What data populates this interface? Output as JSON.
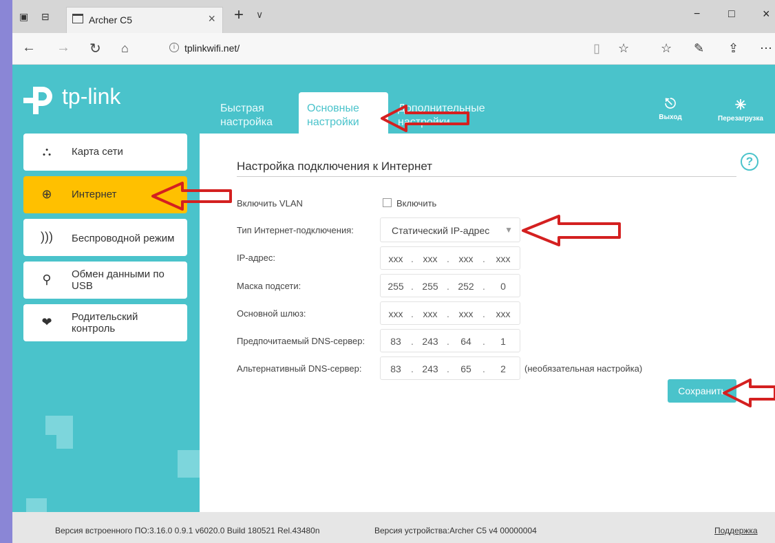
{
  "browser": {
    "tab_title": "Archer C5",
    "tab_close": "×",
    "new_tab": "+",
    "tab_menu": "∨",
    "url": "tplinkwifi.net/",
    "window": {
      "minimize": "−",
      "maximize": "□",
      "close": "×"
    }
  },
  "header": {
    "brand": "tp-link",
    "tabs": [
      {
        "label": "Быстрая настройка"
      },
      {
        "label": "Основные настройки"
      },
      {
        "label": "Дополнительные настройки"
      }
    ],
    "logout_label": "Выход",
    "reboot_label": "Перезагрузка"
  },
  "sidebar": {
    "items": [
      {
        "label": "Карта сети",
        "icon": "network-map-icon"
      },
      {
        "label": "Интернет",
        "icon": "globe-icon"
      },
      {
        "label": "Беспроводной режим",
        "icon": "wireless-icon"
      },
      {
        "label": "Обмен данными по USB",
        "icon": "usb-icon"
      },
      {
        "label": "Родительский контроль",
        "icon": "parental-control-icon"
      }
    ]
  },
  "main": {
    "title": "Настройка подключения к Интернет",
    "help": "?",
    "vlan_label": "Включить VLAN",
    "vlan_checkbox_label": "Включить",
    "connection_type_label": "Тип Интернет-подключения:",
    "connection_type_value": "Статический IP-адрес",
    "ip_label": "IP-адрес:",
    "ip": [
      "xxx",
      "xxx",
      "xxx",
      "xxx"
    ],
    "mask_label": "Маска подсети:",
    "mask": [
      "255",
      "255",
      "252",
      "0"
    ],
    "gateway_label": "Основной шлюз:",
    "gateway": [
      "xxx",
      "xxx",
      "xxx",
      "xxx"
    ],
    "dns1_label": "Предпочитаемый DNS-сервер:",
    "dns1": [
      "83",
      "243",
      "64",
      "1"
    ],
    "dns2_label": "Альтернативный DNS-сервер:",
    "dns2": [
      "83",
      "243",
      "65",
      "2"
    ],
    "dns2_note": "(необязательная настройка)",
    "save_label": "Сохранить"
  },
  "footer": {
    "firmware": "Версия встроенного ПО:3.16.0 0.9.1 v6020.0 Build 180521 Rel.43480n",
    "hardware": "Версия устройства:Archer C5 v4 00000004",
    "support": "Поддержка"
  },
  "colors": {
    "accent": "#4ac3cb",
    "active_menu": "#ffc000",
    "annotation_arrow": "#d42020"
  }
}
